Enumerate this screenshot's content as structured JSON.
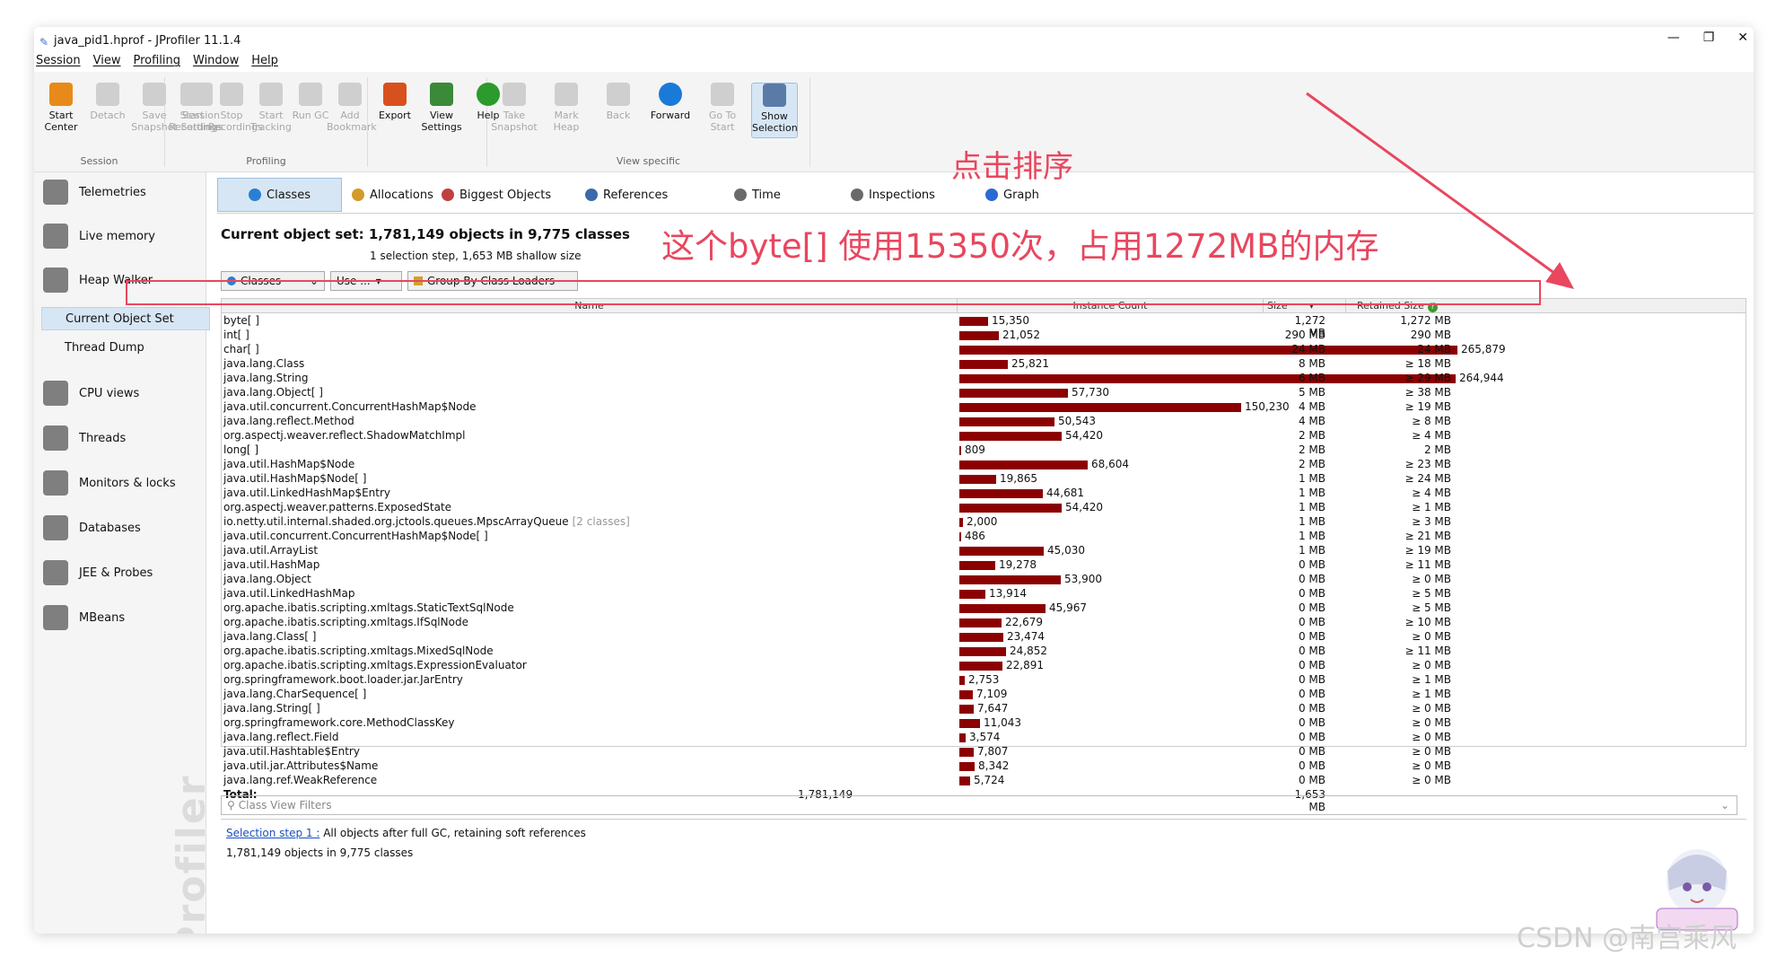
{
  "window": {
    "title": "java_pid1.hprof - JProfiler 11.1.4"
  },
  "menu": [
    "Session",
    "View",
    "Profiling",
    "Window",
    "Help"
  ],
  "toolbar": {
    "groups": [
      {
        "label": "Session",
        "buttons": [
          {
            "l1": "Start",
            "l2": "Center",
            "enabled": true,
            "icon": "start-center-icon"
          },
          {
            "l1": "Detach",
            "l2": "",
            "enabled": false,
            "icon": "detach-icon"
          },
          {
            "l1": "Save",
            "l2": "Snapshot",
            "enabled": false,
            "icon": "save-snapshot-icon"
          },
          {
            "l1": "Session",
            "l2": "Settings",
            "enabled": false,
            "icon": "session-settings-icon"
          }
        ]
      },
      {
        "label": "Profiling",
        "buttons": [
          {
            "l1": "Start",
            "l2": "Recordings",
            "enabled": false,
            "icon": "start-recordings-icon"
          },
          {
            "l1": "Stop",
            "l2": "Recordings",
            "enabled": false,
            "icon": "stop-recordings-icon"
          },
          {
            "l1": "Start",
            "l2": "Tracking",
            "enabled": false,
            "icon": "start-tracking-icon"
          },
          {
            "l1": "Run GC",
            "l2": "",
            "enabled": false,
            "icon": "run-gc-icon"
          },
          {
            "l1": "Add",
            "l2": "Bookmark",
            "enabled": false,
            "icon": "add-bookmark-icon"
          }
        ]
      },
      {
        "label": "",
        "buttons": [
          {
            "l1": "Export",
            "l2": "",
            "enabled": true,
            "icon": "export-icon"
          },
          {
            "l1": "View",
            "l2": "Settings",
            "enabled": true,
            "icon": "view-settings-icon"
          },
          {
            "l1": "Help",
            "l2": "",
            "enabled": true,
            "icon": "help-icon"
          }
        ]
      },
      {
        "label": "View specific",
        "buttons": [
          {
            "l1": "Take",
            "l2": "Snapshot",
            "enabled": false,
            "icon": "take-snapshot-icon"
          },
          {
            "l1": "Mark",
            "l2": "Heap",
            "enabled": false,
            "icon": "mark-heap-icon"
          },
          {
            "l1": "Back",
            "l2": "",
            "enabled": false,
            "icon": "back-icon"
          },
          {
            "l1": "Forward",
            "l2": "",
            "enabled": true,
            "icon": "forward-icon"
          },
          {
            "l1": "Go To",
            "l2": "Start",
            "enabled": false,
            "icon": "go-to-start-icon"
          },
          {
            "l1": "Show",
            "l2": "Selection",
            "enabled": true,
            "icon": "show-selection-icon"
          }
        ]
      }
    ]
  },
  "sidebar": {
    "items": [
      {
        "label": "Telemetries",
        "icon": "telemetries-icon"
      },
      {
        "label": "Live memory",
        "icon": "live-memory-icon"
      },
      {
        "label": "Heap Walker",
        "icon": "heap-walker-icon"
      },
      {
        "label": "CPU views",
        "icon": "cpu-views-icon"
      },
      {
        "label": "Threads",
        "icon": "threads-icon"
      },
      {
        "label": "Monitors & locks",
        "icon": "monitors-locks-icon"
      },
      {
        "label": "Databases",
        "icon": "databases-icon"
      },
      {
        "label": "JEE & Probes",
        "icon": "jee-probes-icon"
      },
      {
        "label": "MBeans",
        "icon": "mbeans-icon"
      }
    ],
    "sub": [
      {
        "label": "Current Object Set"
      },
      {
        "label": "Thread Dump"
      }
    ],
    "watermark": "JProfiler"
  },
  "tabs": [
    {
      "label": "Classes",
      "icon": "classes-icon"
    },
    {
      "label": "Allocations",
      "icon": "allocations-icon"
    },
    {
      "label": "Biggest Objects",
      "icon": "biggest-objects-icon"
    },
    {
      "label": "References",
      "icon": "references-icon"
    },
    {
      "label": "Time",
      "icon": "time-icon"
    },
    {
      "label": "Inspections",
      "icon": "inspections-icon"
    },
    {
      "label": "Graph",
      "icon": "graph-icon"
    }
  ],
  "object_set": {
    "heading": "Current object set:  1,781,149 objects in 9,775 classes",
    "step": "1 selection step, 1,653 MB shallow size"
  },
  "filters": {
    "classes": "Classes",
    "use": "Use ...",
    "group": "Group By Class Loaders"
  },
  "columns": {
    "name": "Name",
    "count": "Instance Count",
    "size": "Size",
    "retained": "Retained Size"
  },
  "rows": [
    {
      "name": "byte[ ]",
      "count": 15350,
      "count_label": "15,350",
      "size": "1,272 MB",
      "retained": "1,272 MB"
    },
    {
      "name": "int[ ]",
      "count": 21052,
      "count_label": "21,052",
      "size": "290 MB",
      "retained": "290 MB"
    },
    {
      "name": "char[ ]",
      "count": 265879,
      "count_label": "265,879",
      "size": "24 MB",
      "retained": "24 MB"
    },
    {
      "name": "java.lang.Class",
      "count": 25821,
      "count_label": "25,821",
      "size": "8 MB",
      "retained": "≥ 18 MB"
    },
    {
      "name": "java.lang.String",
      "count": 264944,
      "count_label": "264,944",
      "size": "6 MB",
      "retained": "≥ 29 MB"
    },
    {
      "name": "java.lang.Object[ ]",
      "count": 57730,
      "count_label": "57,730",
      "size": "5 MB",
      "retained": "≥ 38 MB"
    },
    {
      "name": "java.util.concurrent.ConcurrentHashMap$Node",
      "count": 150230,
      "count_label": "150,230",
      "size": "4 MB",
      "retained": "≥ 19 MB"
    },
    {
      "name": "java.lang.reflect.Method",
      "count": 50543,
      "count_label": "50,543",
      "size": "4 MB",
      "retained": "≥ 8 MB"
    },
    {
      "name": "org.aspectj.weaver.reflect.ShadowMatchImpl",
      "count": 54420,
      "count_label": "54,420",
      "size": "2 MB",
      "retained": "≥ 4 MB"
    },
    {
      "name": "long[ ]",
      "count": 809,
      "count_label": "809",
      "size": "2 MB",
      "retained": "2 MB"
    },
    {
      "name": "java.util.HashMap$Node",
      "count": 68604,
      "count_label": "68,604",
      "size": "2 MB",
      "retained": "≥ 23 MB"
    },
    {
      "name": "java.util.HashMap$Node[ ]",
      "count": 19865,
      "count_label": "19,865",
      "size": "1 MB",
      "retained": "≥ 24 MB"
    },
    {
      "name": "java.util.LinkedHashMap$Entry",
      "count": 44681,
      "count_label": "44,681",
      "size": "1 MB",
      "retained": "≥ 4 MB"
    },
    {
      "name": "org.aspectj.weaver.patterns.ExposedState",
      "count": 54420,
      "count_label": "54,420",
      "size": "1 MB",
      "retained": "≥ 1 MB"
    },
    {
      "name": "io.netty.util.internal.shaded.org.jctools.queues.MpscArrayQueue",
      "suffix": "[2 classes]",
      "count": 2000,
      "count_label": "2,000",
      "size": "1 MB",
      "retained": "≥ 3 MB"
    },
    {
      "name": "java.util.concurrent.ConcurrentHashMap$Node[ ]",
      "count": 486,
      "count_label": "486",
      "size": "1 MB",
      "retained": "≥ 21 MB"
    },
    {
      "name": "java.util.ArrayList",
      "count": 45030,
      "count_label": "45,030",
      "size": "1 MB",
      "retained": "≥ 19 MB"
    },
    {
      "name": "java.util.HashMap",
      "count": 19278,
      "count_label": "19,278",
      "size": "0 MB",
      "retained": "≥ 11 MB"
    },
    {
      "name": "java.lang.Object",
      "count": 53900,
      "count_label": "53,900",
      "size": "0 MB",
      "retained": "≥ 0 MB"
    },
    {
      "name": "java.util.LinkedHashMap",
      "count": 13914,
      "count_label": "13,914",
      "size": "0 MB",
      "retained": "≥ 5 MB"
    },
    {
      "name": "org.apache.ibatis.scripting.xmltags.StaticTextSqlNode",
      "count": 45967,
      "count_label": "45,967",
      "size": "0 MB",
      "retained": "≥ 5 MB"
    },
    {
      "name": "org.apache.ibatis.scripting.xmltags.IfSqlNode",
      "count": 22679,
      "count_label": "22,679",
      "size": "0 MB",
      "retained": "≥ 10 MB"
    },
    {
      "name": "java.lang.Class[ ]",
      "count": 23474,
      "count_label": "23,474",
      "size": "0 MB",
      "retained": "≥ 0 MB"
    },
    {
      "name": "org.apache.ibatis.scripting.xmltags.MixedSqlNode",
      "count": 24852,
      "count_label": "24,852",
      "size": "0 MB",
      "retained": "≥ 11 MB"
    },
    {
      "name": "org.apache.ibatis.scripting.xmltags.ExpressionEvaluator",
      "count": 22891,
      "count_label": "22,891",
      "size": "0 MB",
      "retained": "≥ 0 MB"
    },
    {
      "name": "org.springframework.boot.loader.jar.JarEntry",
      "count": 2753,
      "count_label": "2,753",
      "size": "0 MB",
      "retained": "≥ 1 MB"
    },
    {
      "name": "java.lang.CharSequence[ ]",
      "count": 7109,
      "count_label": "7,109",
      "size": "0 MB",
      "retained": "≥ 1 MB"
    },
    {
      "name": "java.lang.String[ ]",
      "count": 7647,
      "count_label": "7,647",
      "size": "0 MB",
      "retained": "≥ 0 MB"
    },
    {
      "name": "org.springframework.core.MethodClassKey",
      "count": 11043,
      "count_label": "11,043",
      "size": "0 MB",
      "retained": "≥ 0 MB"
    },
    {
      "name": "java.lang.reflect.Field",
      "count": 3574,
      "count_label": "3,574",
      "size": "0 MB",
      "retained": "≥ 0 MB"
    },
    {
      "name": "java.util.Hashtable$Entry",
      "count": 7807,
      "count_label": "7,807",
      "size": "0 MB",
      "retained": "≥ 0 MB"
    },
    {
      "name": "java.util.jar.Attributes$Name",
      "count": 8342,
      "count_label": "8,342",
      "size": "0 MB",
      "retained": "≥ 0 MB"
    },
    {
      "name": "java.lang.ref.WeakReference",
      "count": 5724,
      "count_label": "5,724",
      "size": "0 MB",
      "retained": "≥ 0 MB"
    }
  ],
  "total": {
    "label": "Total:",
    "count": "1,781,149",
    "size": "1,653 MB"
  },
  "view_filter": {
    "placeholder": "Class View Filters"
  },
  "bottom": {
    "link": "Selection step 1 :",
    "desc": " All objects after full GC, retaining soft references",
    "count": "1,781,149 objects in 9,775 classes"
  },
  "annotations": {
    "sort": "点击排序",
    "note": "这个byte[] 使用15350次，占用1272MB的内存",
    "color": "#e8475f"
  },
  "csdn": "CSDN @南宫乘风",
  "bar_color": "#8b0000"
}
